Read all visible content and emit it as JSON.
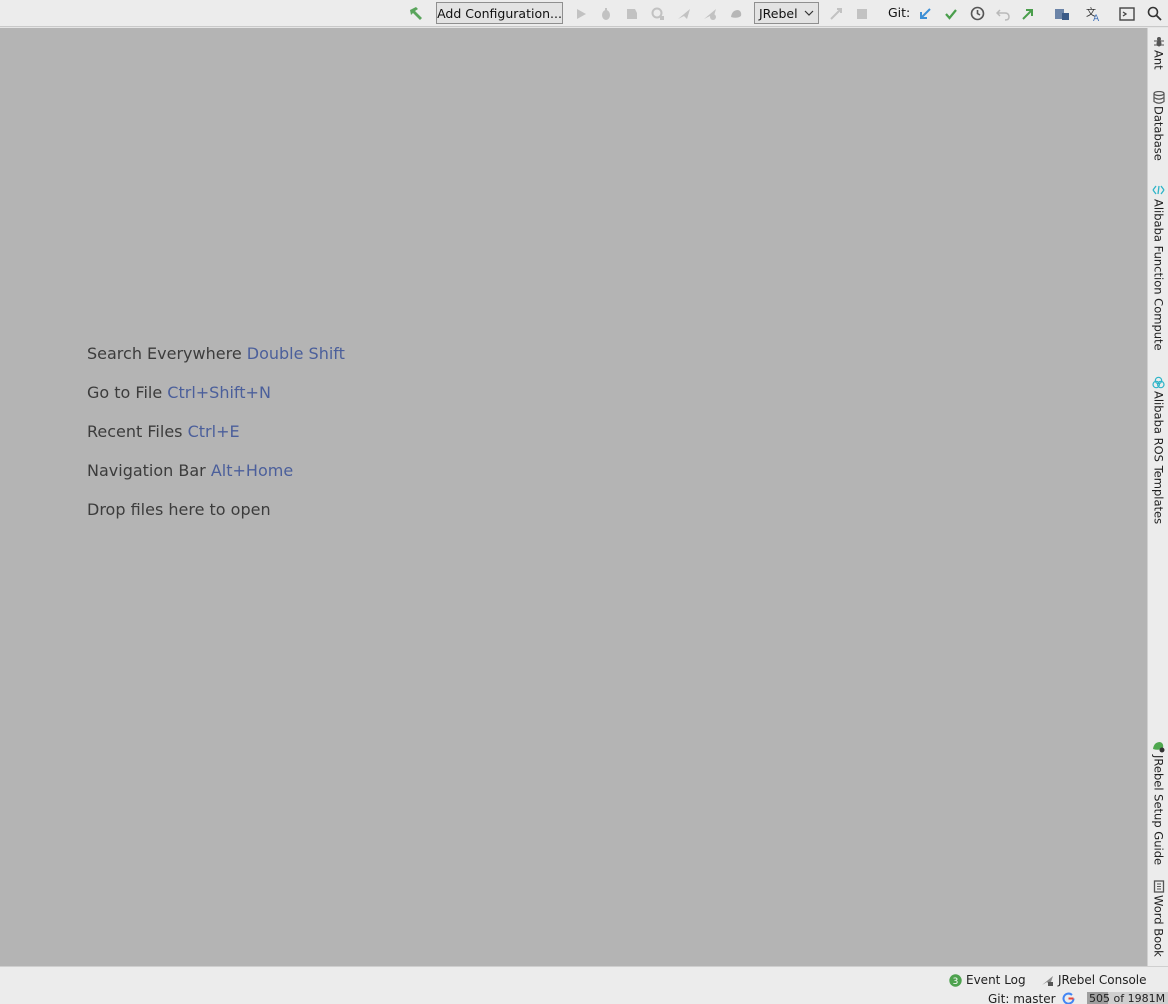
{
  "toolbar": {
    "config_label": "Add Configuration...",
    "run_config": "JRebel",
    "git_label": "Git:",
    "icons": [
      "hammer-icon",
      "run-icon",
      "debug-icon",
      "coverage-icon",
      "profile-icon",
      "jrebel-run-icon",
      "jrebel-debug-icon",
      "jrebel-icon",
      "build-artifact-icon",
      "stop-icon",
      "git-update-icon",
      "git-commit-icon",
      "git-history-icon",
      "git-revert-icon",
      "git-push-icon",
      "project-structure-icon",
      "translate-icon",
      "terminal-icon",
      "search-icon"
    ]
  },
  "hints": [
    {
      "text": "Search Everywhere",
      "shortcut": "Double Shift"
    },
    {
      "text": "Go to File",
      "shortcut": "Ctrl+Shift+N"
    },
    {
      "text": "Recent Files",
      "shortcut": "Ctrl+E"
    },
    {
      "text": "Navigation Bar",
      "shortcut": "Alt+Home"
    },
    {
      "text": "Drop files here to open",
      "shortcut": ""
    }
  ],
  "right_tools": [
    {
      "label": "Ant",
      "icon": "ant-icon"
    },
    {
      "label": "Database",
      "icon": "database-icon"
    },
    {
      "label": "Alibaba Function Compute",
      "icon": "function-compute-icon"
    },
    {
      "label": "Alibaba ROS Templates",
      "icon": "ros-templates-icon"
    },
    {
      "label": "JRebel Setup Guide",
      "icon": "jrebel-guide-icon"
    },
    {
      "label": "Word Book",
      "icon": "word-book-icon"
    }
  ],
  "bottom_tools": [
    {
      "label": "Event Log",
      "badge": "3",
      "icon": "event-log-icon"
    },
    {
      "label": "JRebel Console",
      "icon": "jrebel-console-icon"
    }
  ],
  "status": {
    "git_branch": "Git: master",
    "memory": "505 of 1981M",
    "memory_used_fraction": 0.255
  },
  "colors": {
    "editor_bg": "#b4b4b4",
    "shortcut": "#4b5f9b",
    "hint_text": "#3c3c3c",
    "toolbar_bg": "#ececec"
  }
}
